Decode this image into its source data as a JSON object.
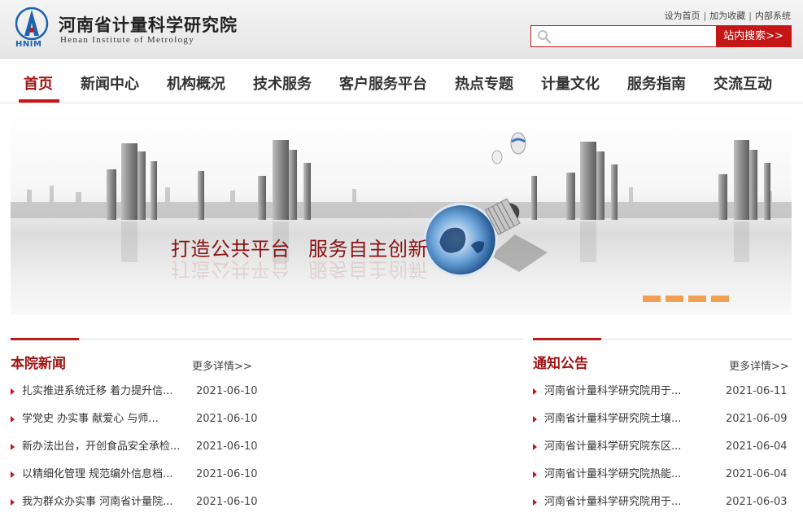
{
  "header": {
    "logo_text": "HNIM",
    "title_cn": "河南省计量科学研究院",
    "title_en": "Henan  Institute  of  Metrology",
    "top_links": [
      "设为首页",
      "加为收藏",
      "内部系统"
    ],
    "search": {
      "placeholder": "",
      "button_label": "站内搜索>>"
    }
  },
  "nav": {
    "items": [
      "首页",
      "新闻中心",
      "机构概况",
      "技术服务",
      "客户服务平台",
      "热点专题",
      "计量文化",
      "服务指南",
      "交流互动"
    ],
    "active_index": 0
  },
  "banner": {
    "slogan_1": "打造公共平台",
    "slogan_2": "服务自主创新",
    "slide_count": 4
  },
  "news": {
    "title": "本院新闻",
    "more_label": "更多详情>>",
    "items": [
      {
        "title": "扎实推进系统迁移 着力提升信...",
        "date": "2021-06-10"
      },
      {
        "title": "学党史 办实事 献爱心 与师...",
        "date": "2021-06-10"
      },
      {
        "title": "新办法出台，开创食品安全承检...",
        "date": "2021-06-10"
      },
      {
        "title": "以精细化管理 规范编外信息档...",
        "date": "2021-06-10"
      },
      {
        "title": "我为群众办实事 河南省计量院...",
        "date": "2021-06-10"
      }
    ]
  },
  "notices": {
    "title": "通知公告",
    "more_label": "更多详情>>",
    "items": [
      {
        "title": "河南省计量科学研究院用于...",
        "date": "2021-06-11"
      },
      {
        "title": "河南省计量科学研究院土壤...",
        "date": "2021-06-09"
      },
      {
        "title": "河南省计量科学研究院东区...",
        "date": "2021-06-04"
      },
      {
        "title": "河南省计量科学研究院热能...",
        "date": "2021-06-04"
      },
      {
        "title": "河南省计量科学研究院用于...",
        "date": "2021-06-03"
      }
    ]
  },
  "colors": {
    "accent": "#c41616",
    "title_red": "#a01414",
    "dot_orange": "#f0a050",
    "logo_blue": "#1b62b0"
  }
}
